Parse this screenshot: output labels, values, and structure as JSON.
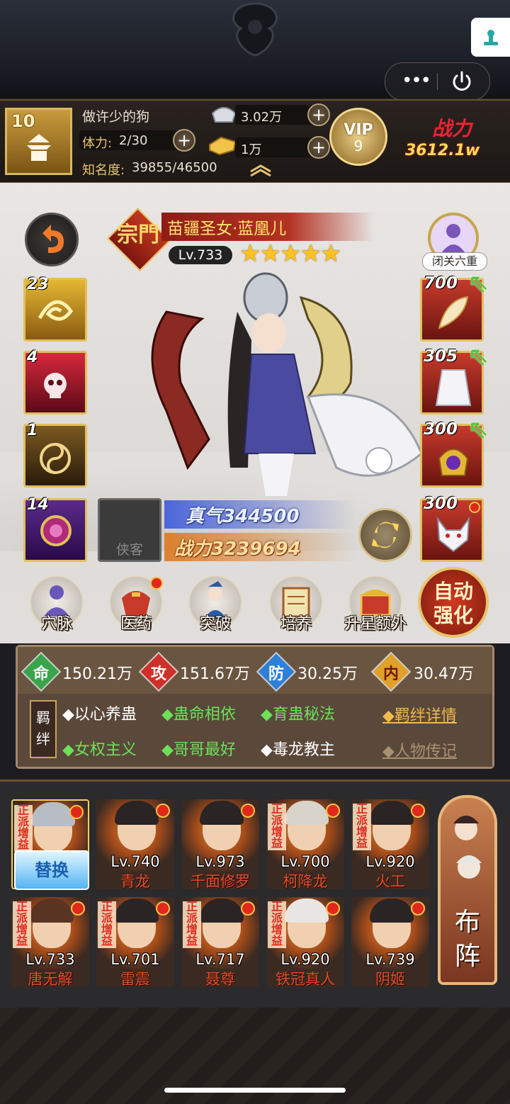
{
  "player": {
    "level": "10",
    "name": "做许少的狗",
    "stamina_label": "体力:",
    "stamina": "2/30",
    "fame_label": "知名度:",
    "fame": "39855/46500",
    "silver": "3.02万",
    "gold": "1万",
    "vip_label": "VIP",
    "vip_level": "9",
    "power_title": "战力",
    "power": "3612.1w"
  },
  "hero": {
    "sect_badge": "宗門",
    "name": "苗疆圣女·蓝凰儿",
    "level": "Lv.733",
    "stars": "★★★★★",
    "star_count": 5,
    "zhenqi": "真气344500",
    "zhanli": "战力3239694",
    "retreat_label": "闭关六重",
    "xiake_label": "侠客"
  },
  "skills": [
    "23",
    "4",
    "1",
    "14"
  ],
  "equipment": [
    "700",
    "305",
    "300",
    "300"
  ],
  "functions": [
    "穴脉",
    "医药",
    "突破",
    "培养",
    "升星额外"
  ],
  "auto_strengthen": "自动强化",
  "stats": [
    {
      "icon": "命",
      "value": "150.21万",
      "color": "#3aa44a"
    },
    {
      "icon": "攻",
      "value": "151.67万",
      "color": "#d0302a"
    },
    {
      "icon": "防",
      "value": "30.25万",
      "color": "#2f7fd8"
    },
    {
      "icon": "内",
      "value": "30.47万",
      "color": "#e0a02a"
    }
  ],
  "bonds": {
    "tag": "羁绊",
    "items": [
      {
        "label": "◆以心养蛊",
        "active": false
      },
      {
        "label": "◆蛊命相依",
        "active": true
      },
      {
        "label": "◆育蛊秘法",
        "active": true
      },
      {
        "label": "◆女权主义",
        "active": true
      },
      {
        "label": "◆哥哥最好",
        "active": true
      },
      {
        "label": "◆毒龙教主",
        "active": false
      }
    ],
    "details_link": "◆羁绊详情",
    "biography_link": "◆人物传记"
  },
  "roster": [
    {
      "tag": "正派增益",
      "level": "",
      "name": ""
    },
    {
      "tag": "",
      "level": "Lv.740",
      "name": "青龙"
    },
    {
      "tag": "",
      "level": "Lv.973",
      "name": "千面修罗"
    },
    {
      "tag": "正派增益",
      "level": "Lv.700",
      "name": "柯降龙"
    },
    {
      "tag": "正派增益",
      "level": "Lv.920",
      "name": "火工"
    },
    {
      "tag": "正派增益",
      "level": "Lv.733",
      "name": "唐无解"
    },
    {
      "tag": "正派增益",
      "level": "Lv.701",
      "name": "雷震"
    },
    {
      "tag": "正派增益",
      "level": "Lv.717",
      "name": "聂尊"
    },
    {
      "tag": "正派增益",
      "level": "Lv.920",
      "name": "铁冠真人"
    },
    {
      "tag": "",
      "level": "Lv.739",
      "name": "阴姬"
    }
  ],
  "replace_label": "替换",
  "formation_label": "布阵"
}
